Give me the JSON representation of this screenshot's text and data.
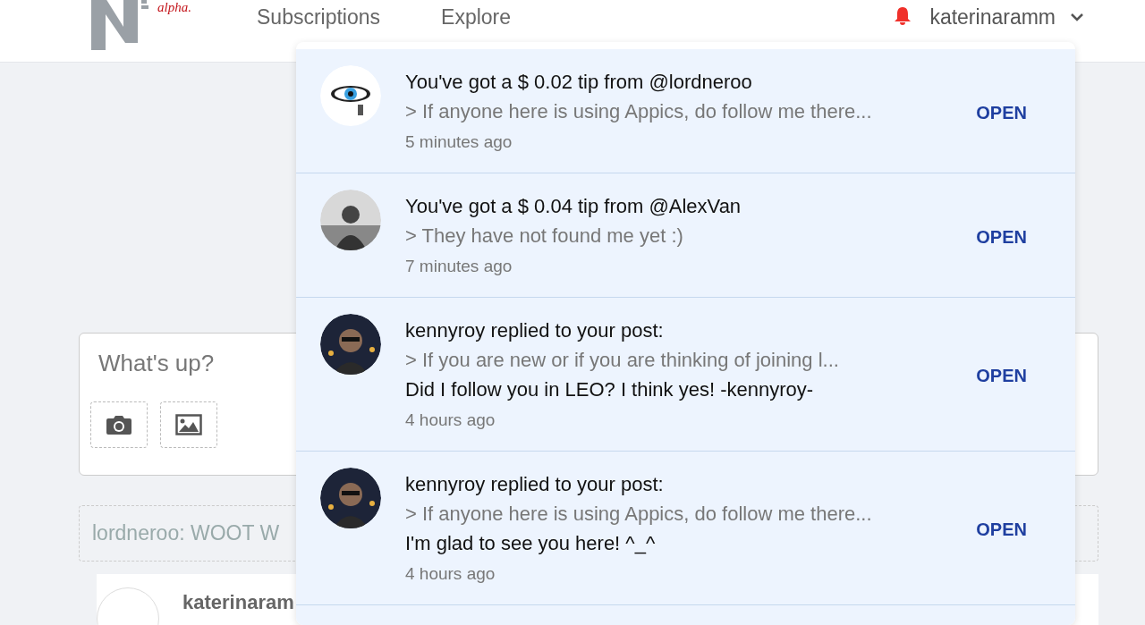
{
  "header": {
    "logo_text": "alpha.",
    "nav": [
      {
        "label": "Subscriptions"
      },
      {
        "label": "Explore"
      }
    ],
    "username": "katerinaramm"
  },
  "composer": {
    "placeholder": "What's up?"
  },
  "notice": {
    "text": "lordneroo: WOOT W"
  },
  "post": {
    "author": "katerinaram"
  },
  "notifications": [
    {
      "title": "You've got a $ 0.02 tip from @lordneroo",
      "quote": "> If anyone here is using Appics, do follow me there...",
      "time": "5 minutes ago",
      "action": "OPEN",
      "kind": "eye"
    },
    {
      "title": "You've got a $ 0.04 tip from @AlexVan",
      "quote": "> They have not found me yet :)",
      "time": "7 minutes ago",
      "action": "OPEN",
      "kind": "grey"
    },
    {
      "title": "kennyroy replied to your post:",
      "quote": "> If you are new or if you are thinking of joining l...",
      "message": "Did I follow you in LEO? I think yes! -kennyroy-",
      "time": "4 hours ago",
      "action": "OPEN",
      "kind": "night"
    },
    {
      "title": "kennyroy replied to your post:",
      "quote": "> If anyone here is using Appics, do follow me there...",
      "message": "I'm glad to see you here! ^_^",
      "time": "4 hours ago",
      "action": "OPEN",
      "kind": "night"
    }
  ]
}
